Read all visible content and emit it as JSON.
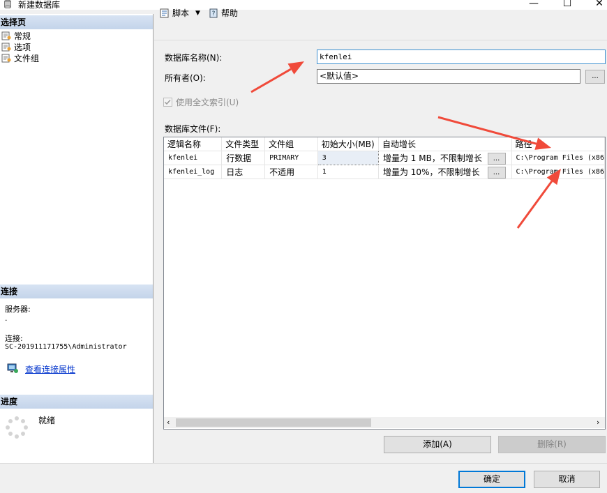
{
  "window": {
    "title": "新建数据库",
    "minimize": "—",
    "maximize": "☐",
    "close": "✕"
  },
  "left": {
    "select_page_header": "选择页",
    "pages": [
      {
        "label": "常规",
        "icon": "page-settings-icon"
      },
      {
        "label": "选项",
        "icon": "page-settings-icon"
      },
      {
        "label": "文件组",
        "icon": "page-settings-icon"
      }
    ],
    "connection_header": "连接",
    "server_label": "服务器:",
    "server_value": ".",
    "connection_label": "连接:",
    "connection_value": "SC-201911171755\\Administrator",
    "view_connection_link": "查看连接属性",
    "progress_header": "进度",
    "progress_status": "就绪"
  },
  "toolbar": {
    "script_label": "脚本",
    "help_label": "帮助"
  },
  "form": {
    "db_name_label": "数据库名称(N):",
    "db_name_value": "kfenlei",
    "owner_label": "所有者(O):",
    "owner_value": "<默认值>",
    "browse_button": "...",
    "fulltext_label": "使用全文索引(U)",
    "fulltext_checked": true,
    "db_files_label": "数据库文件(F):"
  },
  "files_table": {
    "columns": [
      "逻辑名称",
      "文件类型",
      "文件组",
      "初始大小(MB)",
      "自动增长",
      "路径"
    ],
    "rows": [
      {
        "logical_name": "kfenlei",
        "file_type": "行数据",
        "filegroup": "PRIMARY",
        "initial_size": "3",
        "autogrowth": "增量为 1 MB，不限制增长",
        "path": "C:\\Program Files (x86"
      },
      {
        "logical_name": "kfenlei_log",
        "file_type": "日志",
        "filegroup": "不适用",
        "initial_size": "1",
        "autogrowth": "增量为 10%，不限制增长",
        "path": "C:\\Program Files (x86"
      }
    ],
    "ellipsis": "..."
  },
  "buttons": {
    "add": "添加(A)",
    "remove": "删除(R)",
    "ok": "确定",
    "cancel": "取消"
  },
  "colors": {
    "annotation_arrow": "#f04a3a",
    "header_gradient": "#c4d4ea",
    "link": "#0033cc"
  }
}
